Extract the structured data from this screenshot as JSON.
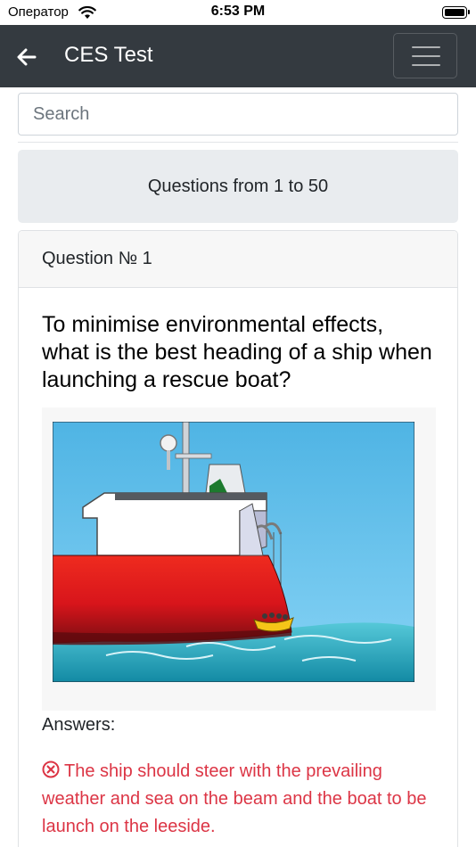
{
  "status_bar": {
    "carrier": "Оператор",
    "time": "6:53 PM",
    "wifi_icon": "wifi-icon",
    "battery_icon": "battery-icon"
  },
  "navbar": {
    "title": "CES Test",
    "back_icon": "arrow-left-icon",
    "menu_icon": "hamburger-menu-icon",
    "background": "#343a40"
  },
  "search": {
    "placeholder": "Search",
    "value": ""
  },
  "range": {
    "label": "Questions from 1 to 50"
  },
  "question": {
    "header": "Question № 1",
    "text": "To minimise environmental effects, what is the best heading of a ship when launching a rescue boat?",
    "image": "ship-launching-rescue-boat-illustration",
    "answers_label": "Answers:",
    "answers": [
      {
        "text": "The ship should steer with the prevailing weather and sea on the beam and the boat to be launch on the leeside.",
        "status": "incorrect",
        "icon": "x-circle-icon",
        "color": "#dc3545"
      }
    ]
  }
}
